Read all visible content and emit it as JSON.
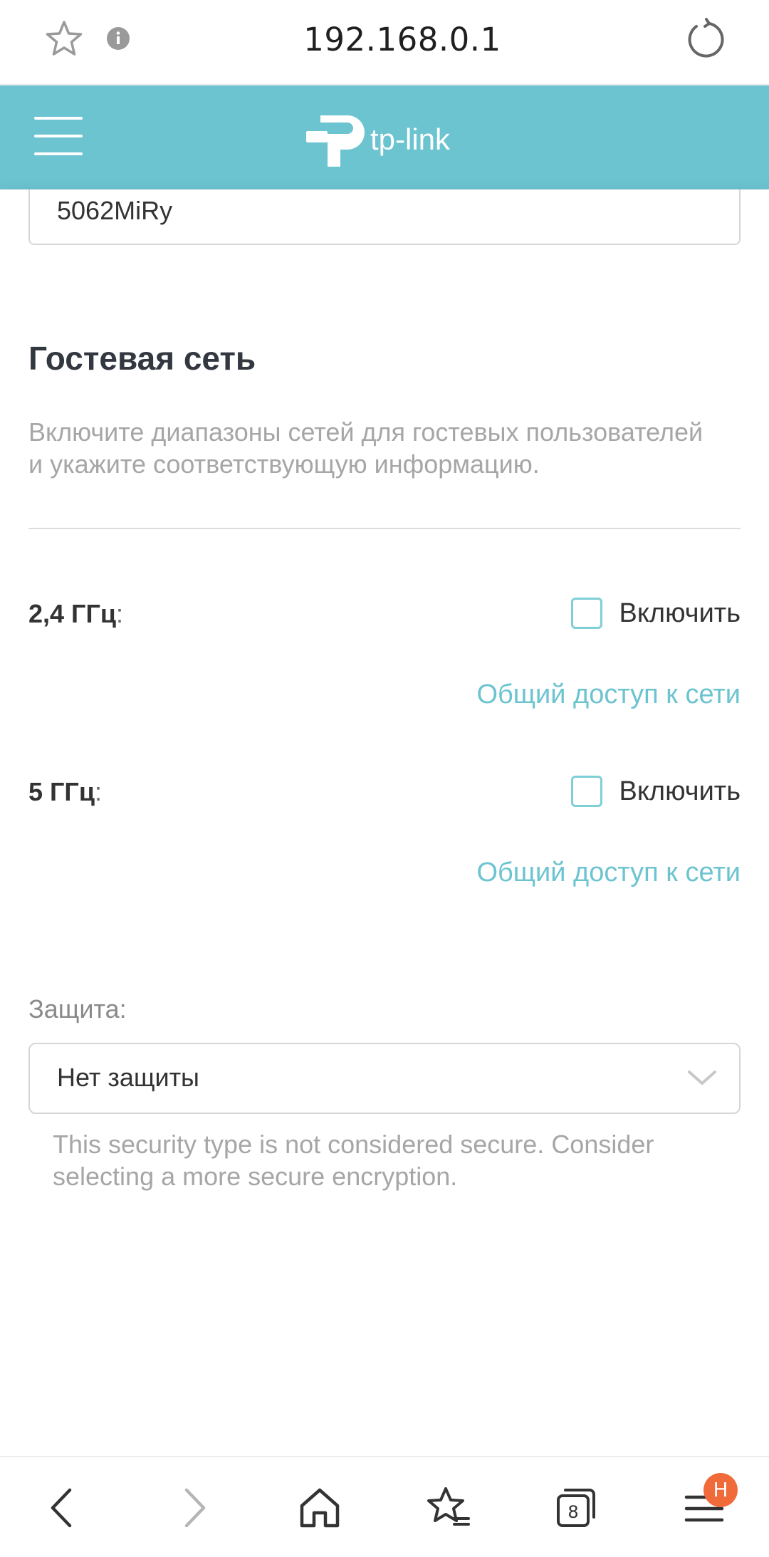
{
  "browser": {
    "url": "192.168.0.1",
    "icons": [
      "star-icon",
      "info-icon",
      "reload-icon"
    ]
  },
  "header": {
    "brand": "tp-link",
    "icons": [
      "menu-icon",
      "tp-link-logo"
    ]
  },
  "wireless": {
    "ssid_value": "5062MiRy"
  },
  "guest": {
    "title": "Гостевая сеть",
    "description": "Включите диапазоны сетей для гостевых пользователей и укажите соответствующую информацию.",
    "bands": [
      {
        "label": "2,4 ГГц",
        "colon": ":",
        "enable_label": "Включить",
        "enabled": false,
        "share_link": "Общий доступ к сети"
      },
      {
        "label": "5 ГГц",
        "colon": ":",
        "enable_label": "Включить",
        "enabled": false,
        "share_link": "Общий доступ к сети"
      }
    ],
    "security_label": "Защита:",
    "security_value": "Нет защиты",
    "security_hint": "This security type is not considered secure. Consider selecting a more secure encryption."
  },
  "bottom_nav": {
    "icons": [
      "back-icon",
      "forward-icon",
      "home-icon",
      "bookmarks-icon",
      "tabs-icon",
      "menu-icon"
    ],
    "tabs_count": "8",
    "menu_badge": "H"
  },
  "colors": {
    "accent": "#6cc4d0",
    "badge": "#f06a3a"
  }
}
